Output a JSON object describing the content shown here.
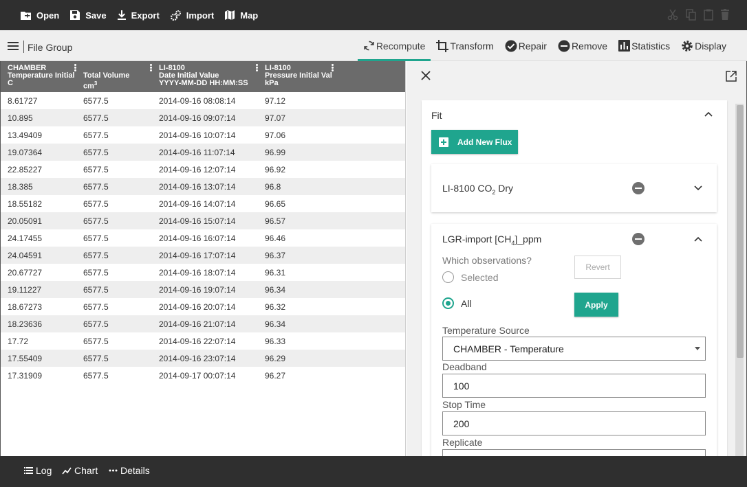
{
  "toolbar": {
    "open": "Open",
    "save": "Save",
    "export": "Export",
    "import": "Import",
    "map": "Map"
  },
  "file_group": {
    "label": "File Group"
  },
  "tabs": {
    "recompute": "Recompute",
    "transform": "Transform",
    "repair": "Repair",
    "remove": "Remove",
    "statistics": "Statistics",
    "display": "Display",
    "active": "recompute"
  },
  "table": {
    "headers": [
      {
        "line1": "CHAMBER",
        "line2": "Temperature Initial",
        "line3": "C"
      },
      {
        "line1": "",
        "line2": "Total Volume",
        "line3": "cm",
        "sup": "3"
      },
      {
        "line1": "LI-8100",
        "line2": "Date Initial Value",
        "line3": "YYYY-MM-DD HH:MM:SS"
      },
      {
        "line1": "LI-8100",
        "line2": "Pressure Initial Val",
        "line3": "kPa"
      }
    ],
    "rows": [
      [
        "8.61727",
        "6577.5",
        "2014-09-16 08:08:14",
        "97.12"
      ],
      [
        "10.895",
        "6577.5",
        "2014-09-16 09:07:14",
        "97.07"
      ],
      [
        "13.49409",
        "6577.5",
        "2014-09-16 10:07:14",
        "97.06"
      ],
      [
        "19.07364",
        "6577.5",
        "2014-09-16 11:07:14",
        "96.99"
      ],
      [
        "22.85227",
        "6577.5",
        "2014-09-16 12:07:14",
        "96.92"
      ],
      [
        "18.385",
        "6577.5",
        "2014-09-16 13:07:14",
        "96.8"
      ],
      [
        "18.55182",
        "6577.5",
        "2014-09-16 14:07:14",
        "96.65"
      ],
      [
        "20.05091",
        "6577.5",
        "2014-09-16 15:07:14",
        "96.57"
      ],
      [
        "24.17455",
        "6577.5",
        "2014-09-16 16:07:14",
        "96.46"
      ],
      [
        "24.04591",
        "6577.5",
        "2014-09-16 17:07:14",
        "96.37"
      ],
      [
        "20.67727",
        "6577.5",
        "2014-09-16 18:07:14",
        "96.31"
      ],
      [
        "19.11227",
        "6577.5",
        "2014-09-16 19:07:14",
        "96.34"
      ],
      [
        "18.67273",
        "6577.5",
        "2014-09-16 20:07:14",
        "96.32"
      ],
      [
        "18.23636",
        "6577.5",
        "2014-09-16 21:07:14",
        "96.34"
      ],
      [
        "17.72",
        "6577.5",
        "2014-09-16 22:07:14",
        "96.33"
      ],
      [
        "17.55409",
        "6577.5",
        "2014-09-16 23:07:14",
        "96.29"
      ],
      [
        "17.31909",
        "6577.5",
        "2014-09-17 00:07:14",
        "96.27"
      ]
    ]
  },
  "panel": {
    "fit_label": "Fit",
    "add_flux": "Add New Flux",
    "flux1": {
      "prefix": "LI-8100 CO",
      "sub": "2",
      "suffix": " Dry"
    },
    "flux2": {
      "prefix": "LGR-import [CH",
      "sub": "4",
      "suffix": "]_ppm",
      "which_obs": "Which observations?",
      "selected": "Selected",
      "all": "All",
      "selected_option": "All",
      "revert": "Revert",
      "apply": "Apply",
      "temp_source_label": "Temperature Source",
      "temp_source_value": "CHAMBER - Temperature",
      "deadband_label": "Deadband",
      "deadband_value": "100",
      "stop_time_label": "Stop Time",
      "stop_time_value": "200",
      "replicate_label": "Replicate"
    }
  },
  "bottombar": {
    "log": "Log",
    "chart": "Chart",
    "details": "Details"
  },
  "colors": {
    "accent": "#1fa58e",
    "topbar": "#2f2f2f",
    "table_header": "#6b6b6b"
  }
}
